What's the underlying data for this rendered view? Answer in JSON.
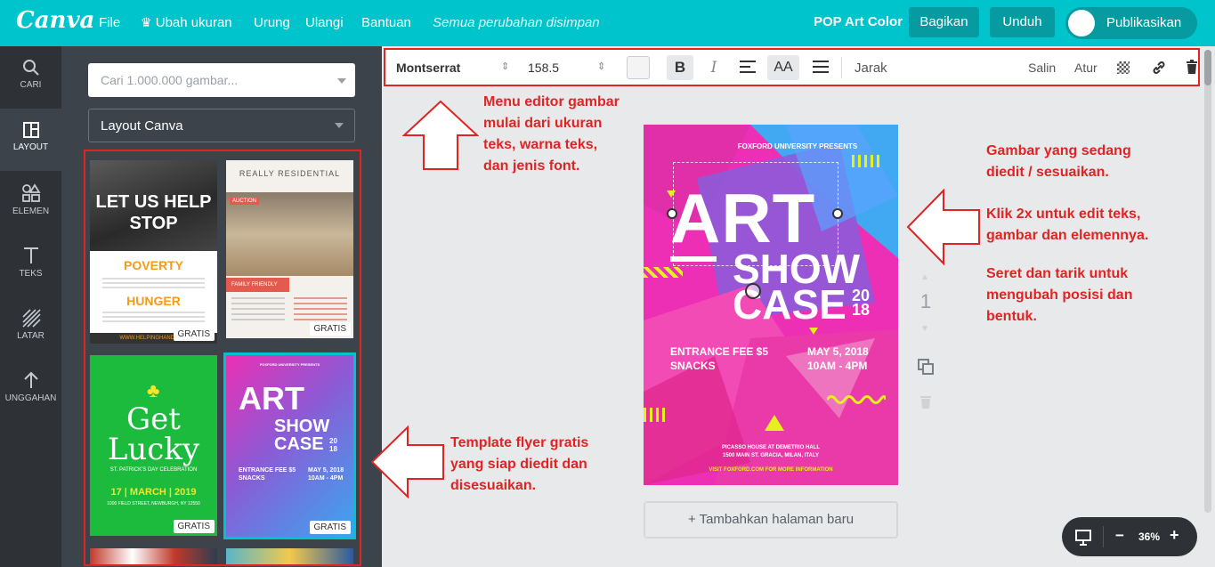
{
  "topbar": {
    "logo": "Canva",
    "menu": {
      "file": "File",
      "resize": "Ubah ukuran",
      "undo": "Urung",
      "redo": "Ulangi",
      "help": "Bantuan"
    },
    "saved_status": "Semua perubahan disimpan",
    "design_title": "POP Art Color",
    "share": "Bagikan",
    "download": "Unduh",
    "publish": "Publikasikan"
  },
  "rail": {
    "search": "CARI",
    "layout": "LAYOUT",
    "elements": "ELEMEN",
    "text": "TEKS",
    "background": "LATAR",
    "uploads": "UNGGAHAN"
  },
  "panel": {
    "search_placeholder": "Cari 1.000.000 gambar...",
    "filter_selected": "Layout Canva",
    "badge": "GRATIS",
    "templates": {
      "t1": {
        "l1": "LET US HELP",
        "l2": "STOP",
        "l3": "POVERTY",
        "l4": "HUNGER",
        "footer": "WWW.HELPINGHANDS.CO"
      },
      "t2": {
        "title": "REALLY RESIDENTIAL",
        "tag": "AUCTION",
        "sub": "FAMILY FRIENDLY"
      },
      "t3": {
        "l1": "Get",
        "l2": "Lucky",
        "sub": "ST. PATRICK'S DAY CELEBRATION",
        "date": "17 | MARCH | 2019",
        "address": "1000 FIELD STREET, NEWBURGH, NY 12550"
      },
      "t4": {
        "top": "FOXFORD UNIVERSITY PRESENTS",
        "art": "ART",
        "show": "SHOW",
        "case": "CASE",
        "year": "20 18",
        "fee": "ENTRANCE FEE $5",
        "snacks": "SNACKS",
        "date": "MAY 5, 2018",
        "time": "10AM - 4PM"
      }
    }
  },
  "toolbar": {
    "font": "Montserrat",
    "size": "158.5",
    "bold": "B",
    "italic": "I",
    "caps": "AA",
    "spacing": "Jarak",
    "copy": "Salin",
    "arrange": "Atur"
  },
  "design": {
    "top": "FOXFORD UNIVERSITY PRESENTS",
    "art": "ART",
    "show": "SHOW",
    "case": "CASE",
    "year_top": "20",
    "year_bottom": "18",
    "fee": "ENTRANCE FEE $5",
    "snacks": "SNACKS",
    "date": "MAY 5, 2018",
    "time": "10AM - 4PM",
    "venue1": "PICASSO HOUSE AT DEMETRIO HALL",
    "venue2": "1500 MAIN ST. GRACIA, MILAN, ITALY",
    "website": "VISIT FOXFORD.COM FOR MORE INFORMATION"
  },
  "page_number": "1",
  "add_page": "+ Tambahkan halaman baru",
  "zoom": {
    "value": "36%",
    "minus": "−",
    "plus": "+"
  },
  "annotations": {
    "toolbar_note": [
      "Menu editor gambar",
      "mulai dari ukuran",
      "teks, warna teks,",
      "dan jenis font."
    ],
    "canvas_note": [
      "Gambar yang sedang",
      "diedit / sesuaikan."
    ],
    "edit_note": [
      "Klik 2x untuk edit teks,",
      "gambar dan elemennya."
    ],
    "drag_note": [
      "Seret dan tarik untuk",
      "mengubah posisi dan",
      "bentuk."
    ],
    "template_note": [
      "Template flyer gratis",
      "yang siap diedit dan",
      "disesuaikan."
    ]
  },
  "colors": {
    "accent": "#00c4cc",
    "annotation_red": "#e02424",
    "art_magenta": "#ec2fb4",
    "art_blue": "#3aa6f0"
  }
}
